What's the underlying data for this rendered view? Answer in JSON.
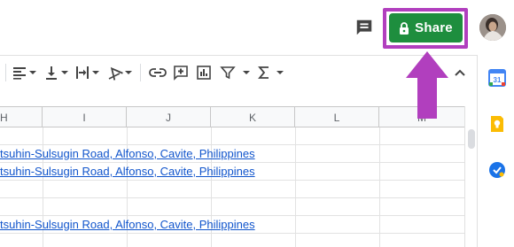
{
  "header": {
    "share_label": "Share",
    "share_color": "#1e8e3e",
    "highlight_color": "#b13fbe"
  },
  "toolbar": {
    "icons": [
      "align-left-icon",
      "align-bottom-icon",
      "text-wrap-icon",
      "text-rotate-icon",
      "link-icon",
      "comment-add-icon",
      "chart-icon",
      "filter-icon",
      "functions-icon",
      "collapse-chevron-icon"
    ]
  },
  "columns": [
    "H",
    "I",
    "J",
    "K",
    "L",
    "M"
  ],
  "rows": [
    {
      "text": ""
    },
    {
      "text": "tsuhin-Sulsugin Road, Alfonso, Cavite, Philippines"
    },
    {
      "text": "tsuhin-Sulsugin Road, Alfonso, Cavite, Philippines"
    },
    {
      "text": ""
    },
    {
      "text": ""
    },
    {
      "text": "tsuhin-Sulsugin Road, Alfonso, Cavite, Philippines"
    },
    {
      "text": ""
    }
  ],
  "side_panel": {
    "icons": [
      "calendar-icon",
      "keep-icon",
      "tasks-icon"
    ],
    "calendar_day": "31"
  }
}
